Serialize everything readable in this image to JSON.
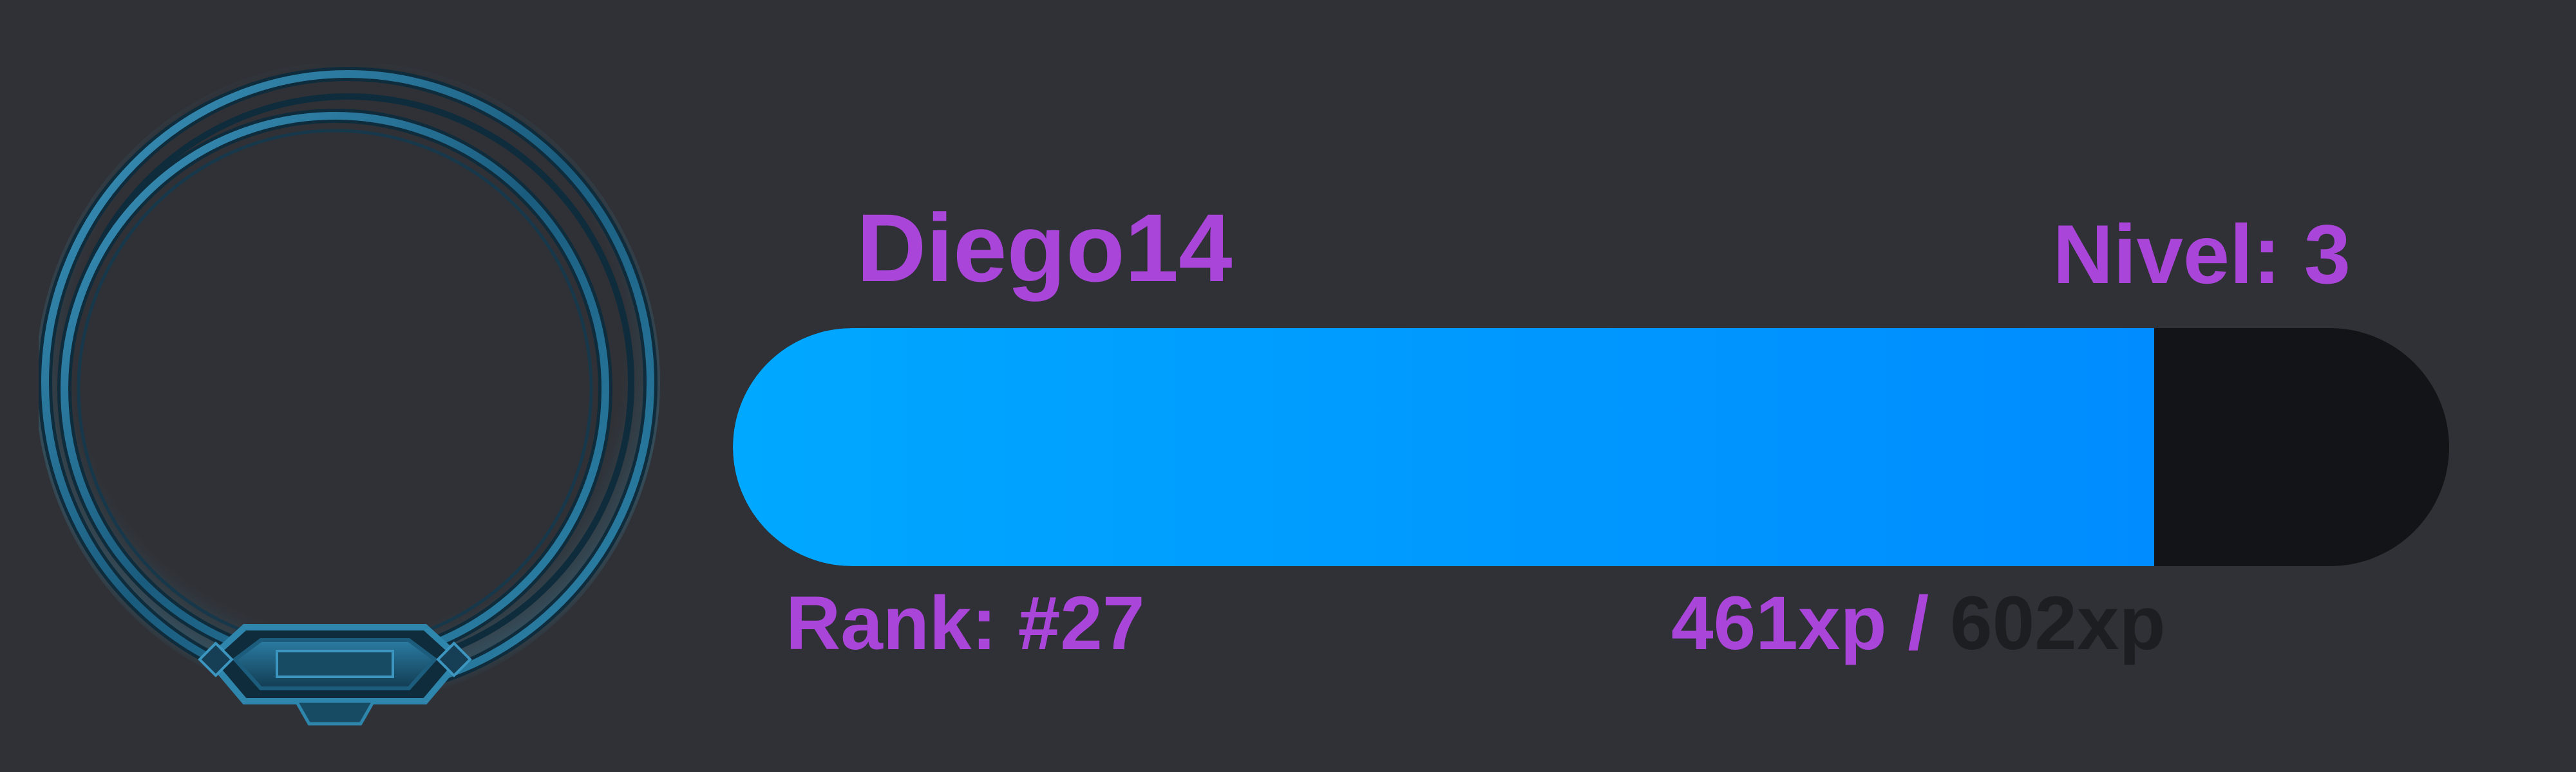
{
  "profile": {
    "username": "Diego14",
    "level_label": "Nivel:",
    "level_value": "3",
    "rank_label": "Rank:",
    "rank_value": "#27"
  },
  "xp": {
    "current_label": "461xp",
    "separator": "/",
    "max_label": "602xp",
    "current": 461,
    "max": 602,
    "fill_fraction": 0.828
  },
  "avatar": {
    "icon": "ring-frame-icon",
    "image": null
  },
  "colors": {
    "background": "#2f3136",
    "text_accent": "#a945d8",
    "bar_fill": "#00a8ff",
    "bar_track": "#131417",
    "frame": "#1f6c8e"
  }
}
